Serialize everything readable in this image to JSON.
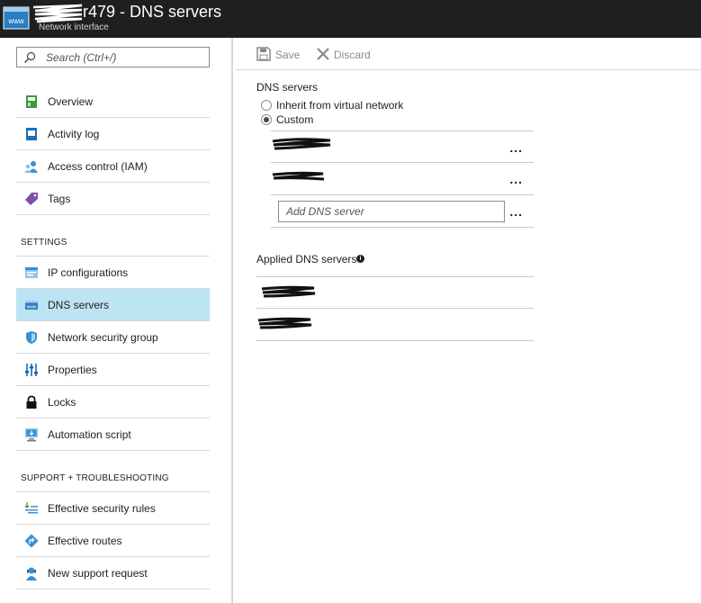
{
  "header": {
    "title": "r479 - DNS servers",
    "subtitle": "Network interface",
    "icon": "network-interface-icon",
    "icon_text": "www"
  },
  "sidebar": {
    "search": {
      "placeholder": "Search (Ctrl+/)"
    },
    "items": [
      {
        "label": "Overview",
        "icon": "overview-icon"
      },
      {
        "label": "Activity log",
        "icon": "activity-log-icon"
      },
      {
        "label": "Access control (IAM)",
        "icon": "iam-icon"
      },
      {
        "label": "Tags",
        "icon": "tag-icon"
      }
    ],
    "settings_header": "SETTINGS",
    "settings_items": [
      {
        "label": "IP configurations",
        "icon": "ip-config-icon"
      },
      {
        "label": "DNS servers",
        "icon": "dns-icon",
        "active": true
      },
      {
        "label": "Network security group",
        "icon": "shield-icon"
      },
      {
        "label": "Properties",
        "icon": "properties-icon"
      },
      {
        "label": "Locks",
        "icon": "lock-icon"
      },
      {
        "label": "Automation script",
        "icon": "automation-icon"
      }
    ],
    "support_header": "SUPPORT + TROUBLESHOOTING",
    "support_items": [
      {
        "label": "Effective security rules",
        "icon": "security-rules-icon"
      },
      {
        "label": "Effective routes",
        "icon": "routes-icon"
      },
      {
        "label": "New support request",
        "icon": "support-icon"
      }
    ]
  },
  "toolbar": {
    "save_label": "Save",
    "discard_label": "Discard"
  },
  "main": {
    "dns_servers_label": "DNS servers",
    "options": [
      {
        "label": "Inherit from virtual network",
        "selected": false
      },
      {
        "label": "Custom",
        "selected": true
      }
    ],
    "more_label": "...",
    "add_dns_placeholder": "Add DNS server",
    "applied_label": "Applied DNS servers",
    "info_glyph": "i"
  },
  "colors": {
    "header_bg": "#1f1f1f",
    "active_item_bg": "#bce4f3",
    "border": "#d8d8d8"
  }
}
